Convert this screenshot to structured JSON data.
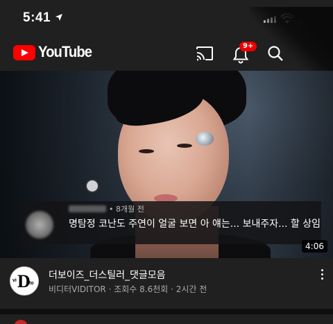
{
  "status_bar": {
    "time": "5:41"
  },
  "header": {
    "logo_text": "YouTube",
    "notification_badge": "9+",
    "brand_color": "#ff0000"
  },
  "video": {
    "comment": {
      "meta": "• 8개월 전",
      "text": "명탐정 코난도 주연이 얼굴 보면 아 얘는... 보내주자... 할 상임"
    },
    "duration": "4:06"
  },
  "meta": {
    "title": "더보이즈_더스틸러_댓글모음",
    "subtitle": "비디터VIDITOR · 조회수 8.6천회 · 2시간 전"
  }
}
